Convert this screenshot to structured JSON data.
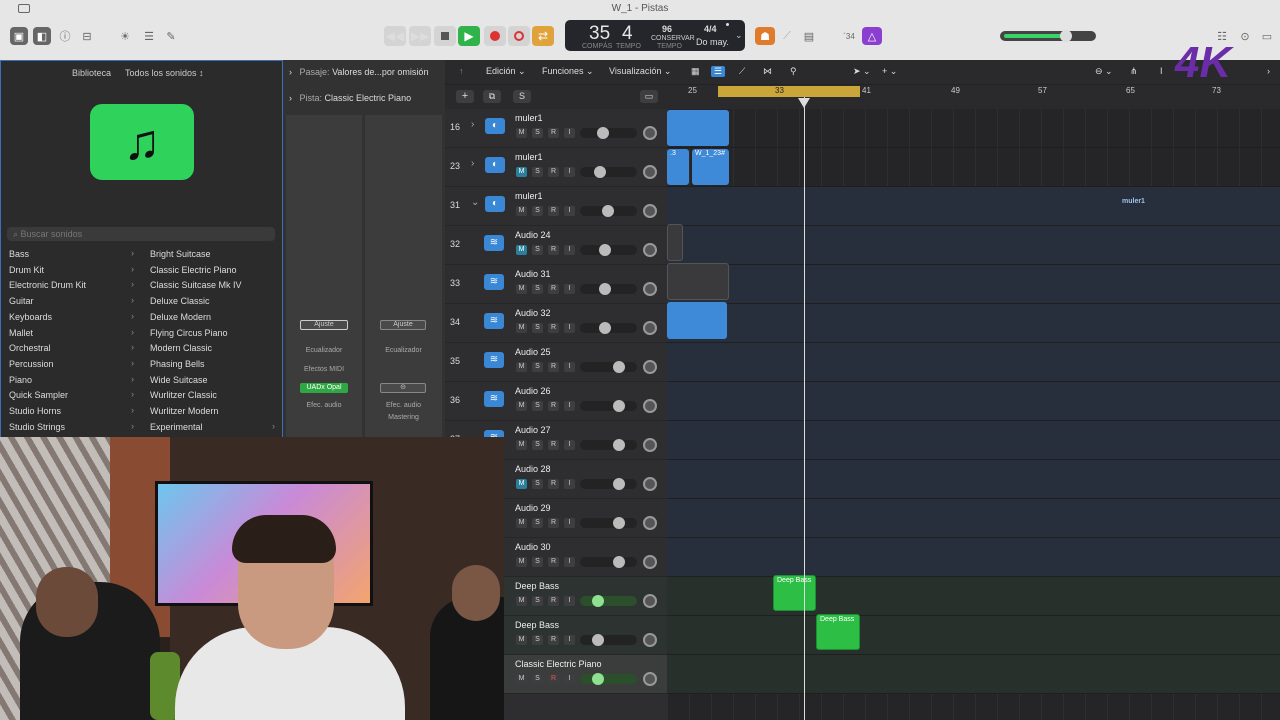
{
  "window": {
    "title": "W_1 - Pistas"
  },
  "lcd": {
    "bar": "35",
    "beat": "4",
    "bar_label": "COMPÁS",
    "beat_label": "TEMPO",
    "tempo": "96",
    "tempo_mode": "CONSERVAR",
    "tempo_label": "TEMPO",
    "signature": "4/4",
    "key": "Do may."
  },
  "toolbar": {
    "cpu_label": "´34"
  },
  "library": {
    "title": "Biblioteca",
    "selector": "Todos los sonidos ↕",
    "search_placeholder": "Buscar sonidos",
    "categories": [
      "Bass",
      "Drum Kit",
      "Electronic Drum Kit",
      "Guitar",
      "Keyboards",
      "Mallet",
      "Orchestral",
      "Percussion",
      "Piano",
      "Quick Sampler",
      "Studio Horns",
      "Studio Strings"
    ],
    "sounds": [
      "Bright Suitcase",
      "Classic Electric Piano",
      "Classic Suitcase Mk IV",
      "Deluxe Classic",
      "Deluxe Modern",
      "Flying Circus Piano",
      "Modern Classic",
      "Phasing Bells",
      "Wide Suitcase",
      "Wurlitzer Classic",
      "Wurlitzer Modern",
      "Experimental"
    ]
  },
  "inspector": {
    "region_label": "Pasaje:",
    "region_value": "Valores de...por omisión",
    "track_label": "Pista:",
    "track_value": "Classic Electric Piano",
    "strip1": {
      "setting": "Ajuste",
      "eq": "Ecualizador",
      "midi_fx": "Efectos MIDI",
      "plugin": "UADx Opal",
      "audio_fx": "Efec. audio"
    },
    "strip2": {
      "setting": "Ajuste",
      "eq": "Ecualizador",
      "audio_fx": "Efec. audio",
      "mastering": "Mastering"
    }
  },
  "menus": {
    "edit": "Edición",
    "functions": "Funciones",
    "view": "Visualización"
  },
  "track_header_toolbar": {
    "solo": "S"
  },
  "ruler": {
    "bars": [
      "25",
      "33",
      "41",
      "49",
      "57",
      "65",
      "73"
    ]
  },
  "tracks": [
    {
      "num": "16",
      "name": "muler1",
      "type": "summing",
      "m_on": false
    },
    {
      "num": "23",
      "name": "muler1",
      "type": "summing",
      "m_on": true
    },
    {
      "num": "31",
      "name": "muler1",
      "type": "summing",
      "m_on": false
    },
    {
      "num": "32",
      "name": "Audio 24",
      "type": "audio",
      "m_on": true
    },
    {
      "num": "33",
      "name": "Audio 31",
      "type": "audio",
      "m_on": false
    },
    {
      "num": "34",
      "name": "Audio 32",
      "type": "audio",
      "m_on": false
    },
    {
      "num": "35",
      "name": "Audio 25",
      "type": "audio",
      "m_on": false
    },
    {
      "num": "36",
      "name": "Audio 26",
      "type": "audio",
      "m_on": false
    },
    {
      "num": "37",
      "name": "Audio 27",
      "type": "audio",
      "m_on": false
    },
    {
      "num": "",
      "name": "Audio 28",
      "type": "audio",
      "m_on": true
    },
    {
      "num": "",
      "name": "Audio 29",
      "type": "audio",
      "m_on": false
    },
    {
      "num": "",
      "name": "Audio 30",
      "type": "audio",
      "m_on": false
    },
    {
      "num": "",
      "name": "Deep Bass",
      "type": "inst",
      "m_on": false
    },
    {
      "num": "",
      "name": "Deep Bass",
      "type": "inst",
      "m_on": false
    },
    {
      "num": "",
      "name": "Classic Electric Piano",
      "type": "inst",
      "m_on": false
    }
  ],
  "msr_labels": {
    "m": "M",
    "s": "S",
    "r": "R",
    "i": "I"
  },
  "regions": {
    "r23a": ".3",
    "r23b": "W_1_23#",
    "r31": "muler1",
    "bass1": "Deep Bass",
    "bass2": "Deep Bass"
  },
  "logo": "4K"
}
